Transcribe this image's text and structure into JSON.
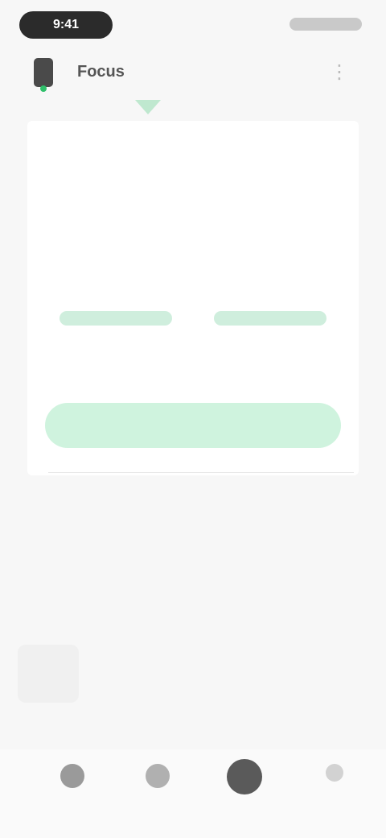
{
  "status_bar": {
    "time": "9:41"
  },
  "header": {
    "title": "Focus",
    "menu_icon": "more-vertical-icon"
  },
  "calendar": {
    "rows": [
      [
        "",
        "",
        "",
        "",
        "",
        "",
        ""
      ],
      [
        "",
        "",
        "",
        "",
        "",
        "",
        ""
      ],
      [
        "",
        "",
        "",
        "",
        "",
        "",
        ""
      ]
    ]
  },
  "timer": {
    "left_value": "",
    "left_label": "",
    "right_value": "",
    "right_label": "",
    "confirm_label": ""
  },
  "link_text": "",
  "section_title": "",
  "tabs": [
    {
      "label": "",
      "sub": ""
    },
    {
      "label": ""
    },
    {
      "label": ""
    },
    {
      "label": ""
    }
  ],
  "tag_line": "",
  "bottom_nav": [
    {
      "icon": "home-icon",
      "label": ""
    },
    {
      "icon": "calendar-icon",
      "label": ""
    },
    {
      "icon": "timer-icon",
      "label": ""
    },
    {
      "icon": "profile-icon",
      "label": ""
    }
  ],
  "colors": {
    "accent": "#3fbb74",
    "accent_light": "#cff3de"
  }
}
